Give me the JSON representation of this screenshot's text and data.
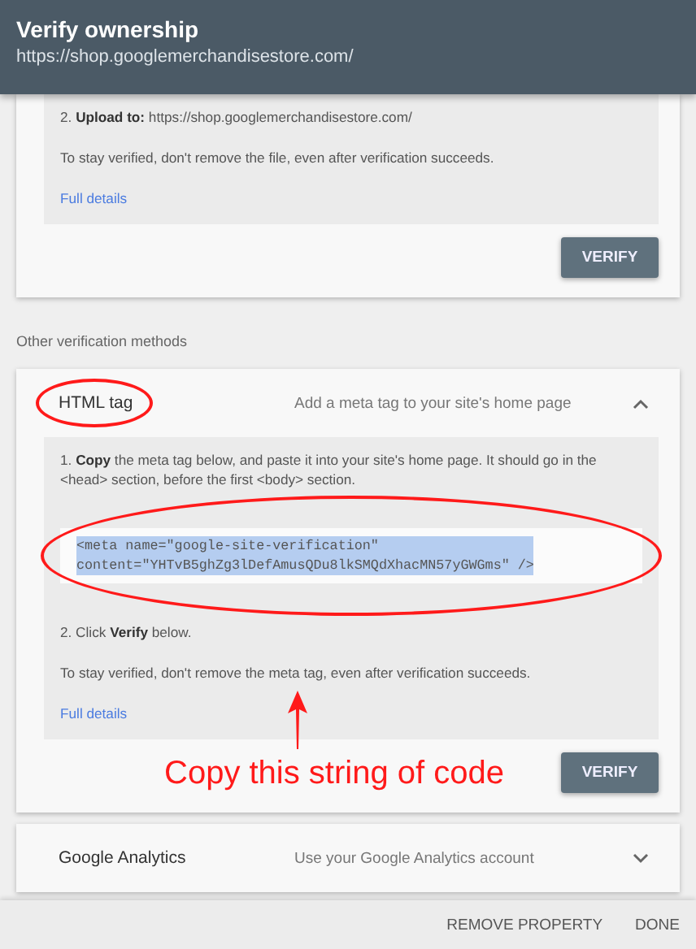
{
  "header": {
    "title": "Verify ownership",
    "url": "https://shop.googlemerchandisestore.com/"
  },
  "upper_card": {
    "step": "2. **Upload to:** https://shop.googlemerchandisestore.com/",
    "note": "To stay verified, don't remove the file, even after verification succeeds.",
    "link": "Full details",
    "button": "VERIFY"
  },
  "section_label": "Other verification methods",
  "methods": [
    {
      "name": "HTML tag",
      "description": "Add a meta tag to your site's home page",
      "expanded": true,
      "step_1": "1. **Copy** the meta tag below, and paste it into your site's home page. It should go in the <head> section, before the first <body> section.",
      "code_lines": [
        "<meta name=\"google-site-verification\"",
        "content=\"YHTvB5ghZg3lDefAmusQDu8lkSMQdXhacMN57yGWGms\" />"
      ],
      "code_highlighted": true,
      "step_2": "2. Click **Verify** below.",
      "note": "To stay verified, don't remove the meta tag, even after verification succeeds.",
      "link": "Full details",
      "button": "VERIFY"
    },
    {
      "name": "Google Analytics",
      "description": "Use your Google Analytics account",
      "expanded": false
    }
  ],
  "footer_buttons": [
    "REMOVE PROPERTY",
    "DONE"
  ],
  "annotation": {
    "text": "Copy this string of code"
  }
}
